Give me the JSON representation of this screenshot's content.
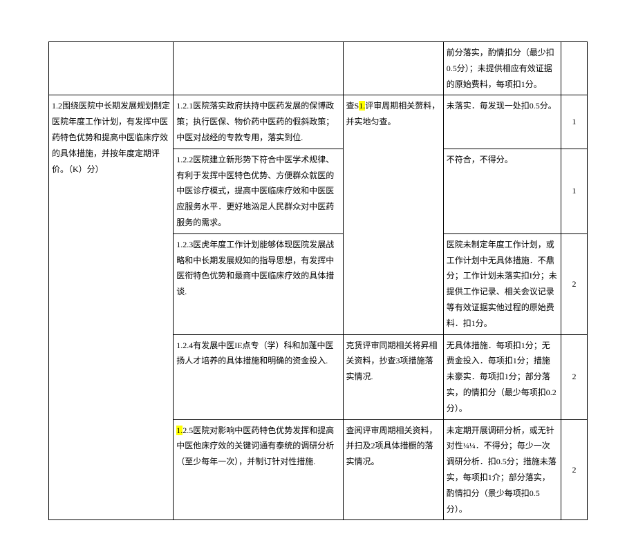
{
  "row0": {
    "c4": "前分落实，酌情扣分（最少扣0.5分）；未提供相应有效证据的原始费料，每项扣1分。",
    "c5": ""
  },
  "group": {
    "c1": "1.2围绕医院中长期发展规划制定医院年度工作计划，有发挥中医药特色优势和提高中医临床疗效的具体措施，并按年度定期评价。（K）分）"
  },
  "r1": {
    "c2": "1.2.1医院落实政府扶持中医药发展的保博政策；执行医保、物价药中医药的假斜政策；中医对战经的专款专用，落实到位.",
    "c3_pre": "查S",
    "c3_hl": "1.",
    "c3_post": "评审周期相关赘料，并实地匀查。",
    "c4": "未落实．毎发现一处扣0.5分。",
    "c5": "1"
  },
  "r2": {
    "c2": "1.2.2医院建立新形势下符合中医学术规律、有利于发挥中医特色优势、方便群众就医的中医诊疗模式，提高中医临床疗效和中医医应服务水平．更好地汹足人民群众对中医药服务的需求。",
    "c4": "不符合，不得分。",
    "c5": "1"
  },
  "r3": {
    "c2": "1.2.3医虎年度工作计划能够体现医院发展战略和中长期发展规知的指导思想，有发挥中医衔特色优势和最商中医临床疗效的具体措谈.",
    "c4": "医院未制定年度工作计划，或工作计划中无具体措施．不鼎分；工作计划未落实扣I分；未提供工作记录、相关会议记录等有效证据实他过程的原始费料．扣1分。",
    "c5": "2"
  },
  "r4": {
    "c2": "1.2.4有发展中医IE点专（学）科和加蓬中医扬人才培养的具体措施和明确的资金投入.",
    "c3": "克赁评审同期相关将昇相关资料，抄查3项措施落实情况.",
    "c4": "无具体措施．每项扣1分；无费金投入．毎项扣1分；措施未豪实．毎项扣1分；部分落实，的情扣分（最少每项扣0.2分）。",
    "c5": "2"
  },
  "r5": {
    "c2_hl": "1.",
    "c2_post": "2.5医院对影响中医药特色优势发挥和提高中医他床疗效的关键诃通有泰统的调研分析（至少每年一次），并制订针对性措施.",
    "c3": "查阅评审周期相关资料，并扫及2项具体措橱的落实情况。",
    "c4": "未定期开展调研分析，或无针对性¼¼．不得分；毎少一次调研分析．扣0.5分；措施未落实，每项扣1介；部分落实，酌情扣分（景少每项扣0.5分）。",
    "c5": "2"
  }
}
